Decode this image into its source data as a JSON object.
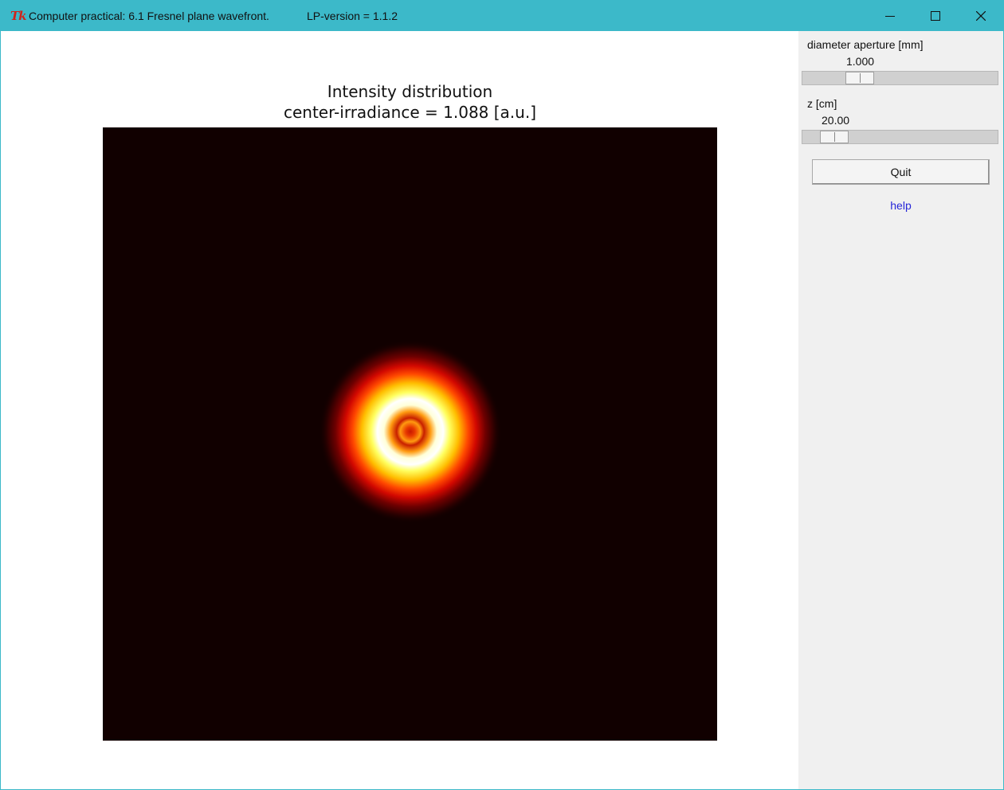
{
  "window": {
    "title": "Computer practical: 6.1 Fresnel plane wavefront.",
    "version": "LP-version = 1.1.2",
    "app_icon": "Tk",
    "title_bar_color": "#3cb9c9"
  },
  "plot": {
    "title_line1": "Intensity distribution",
    "title_line2": "center-irradiance = 1.088 [a.u.]",
    "colormap": "hot",
    "background_color": "#110000"
  },
  "controls": {
    "diameter": {
      "label": "diameter aperture [mm]",
      "value": "1.000"
    },
    "z": {
      "label": "z [cm]",
      "value": "20.00"
    },
    "quit_label": "Quit",
    "help_label": "help",
    "help_color": "#2727d8"
  }
}
